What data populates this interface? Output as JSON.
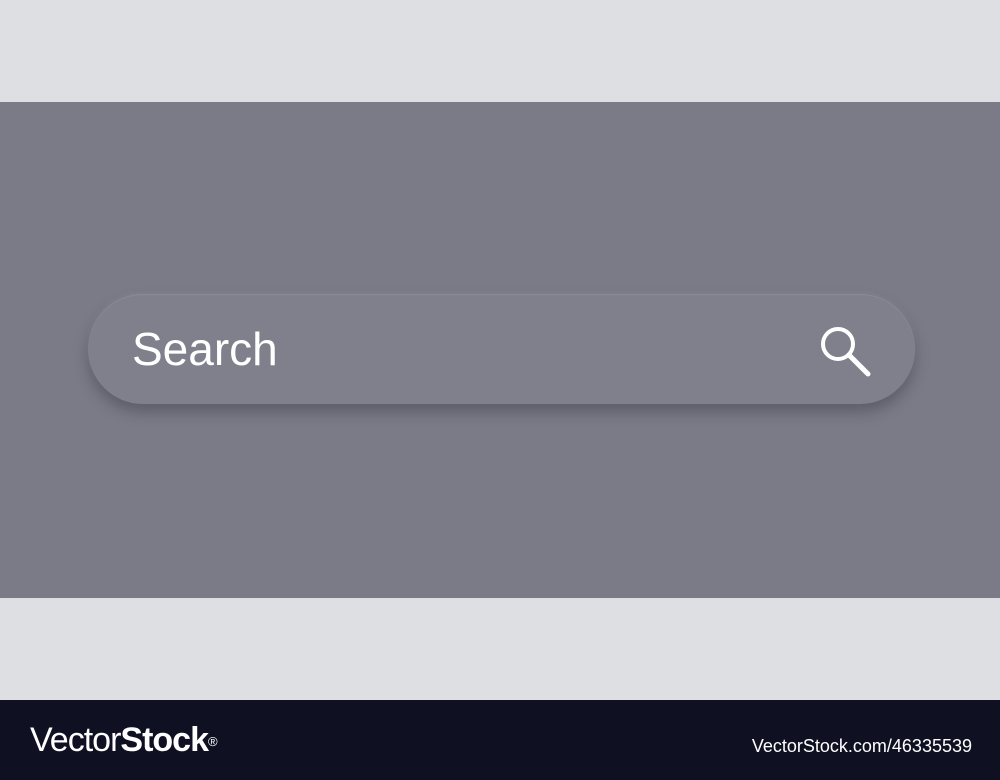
{
  "search": {
    "placeholder": "Search",
    "value": "",
    "icon": "search-icon"
  },
  "footer": {
    "logo_regular": "Vector",
    "logo_bold": "Stock",
    "logo_mark": "®",
    "image_id": "VectorStock.com/46335539"
  },
  "colors": {
    "stage_background": "#7b7b87",
    "band_background": "#dedfe3",
    "search_bar_fill": "#80808c",
    "text_and_icon": "#ffffff",
    "footer_background": "#0f1123"
  }
}
